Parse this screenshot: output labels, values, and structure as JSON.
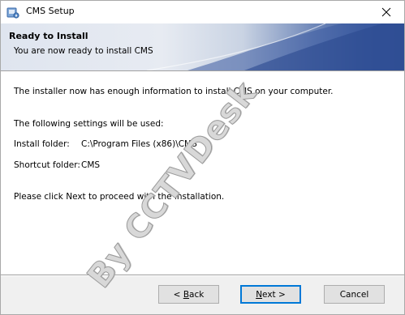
{
  "window": {
    "title": "CMS Setup"
  },
  "banner": {
    "title": "Ready to Install",
    "subtitle": "You are now ready to install CMS"
  },
  "content": {
    "intro": "The installer now has enough information to install CMS on your computer.",
    "settings_heading": "The following settings will be used:",
    "install_folder_label": "Install folder:",
    "install_folder_value": "C:\\Program Files (x86)\\CMS",
    "shortcut_folder_label": "Shortcut folder:",
    "shortcut_folder_value": "CMS",
    "instruction": "Please click Next to proceed with the installation."
  },
  "buttons": {
    "back_pre": "< ",
    "back_key": "B",
    "back_rest": "ack",
    "next_key": "N",
    "next_rest": "ext >",
    "cancel": "Cancel"
  },
  "watermark": "By CCTVDesk",
  "icons": {
    "app": "installer-icon",
    "close": "close-icon"
  },
  "colors": {
    "banner_dark": "#2f4f96",
    "default_button_border": "#0078d7"
  }
}
